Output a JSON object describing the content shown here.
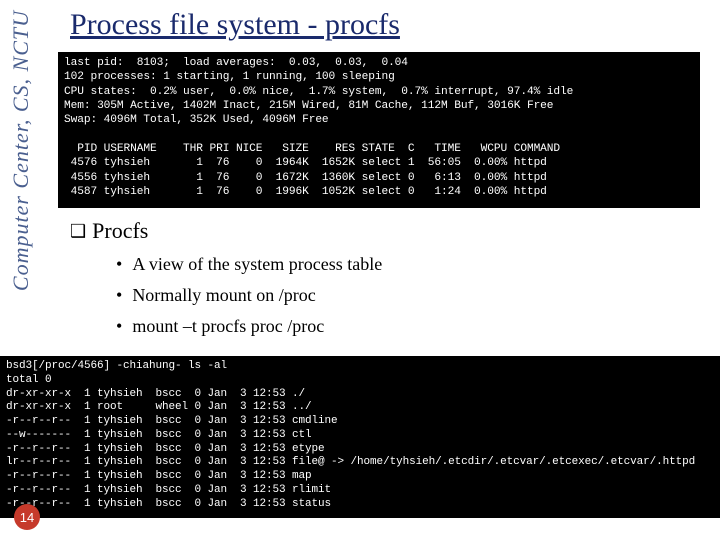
{
  "sidebar": {
    "org": "Computer Center, CS, NCTU"
  },
  "title": "Process file system - procfs",
  "terminal1": {
    "lines": [
      "last pid:  8103;  load averages:  0.03,  0.03,  0.04",
      "102 processes: 1 starting, 1 running, 100 sleeping",
      "CPU states:  0.2% user,  0.0% nice,  1.7% system,  0.7% interrupt, 97.4% idle",
      "Mem: 305M Active, 1402M Inact, 215M Wired, 81M Cache, 112M Buf, 3016K Free",
      "Swap: 4096M Total, 352K Used, 4096M Free",
      "",
      "  PID USERNAME    THR PRI NICE   SIZE    RES STATE  C   TIME   WCPU COMMAND",
      " 4576 tyhsieh       1  76    0  1964K  1652K select 1  56:05  0.00% httpd",
      " 4556 tyhsieh       1  76    0  1672K  1360K select 0   6:13  0.00% httpd",
      " 4587 tyhsieh       1  76    0  1996K  1052K select 0   1:24  0.00% httpd"
    ]
  },
  "section": {
    "heading": "Procfs",
    "bullets": [
      "A view of the system process table",
      "Normally mount on /proc",
      "mount –t procfs proc /proc"
    ]
  },
  "terminal2": {
    "lines": [
      "bsd3[/proc/4566] -chiahung- ls -al",
      "total 0",
      "dr-xr-xr-x  1 tyhsieh  bscc  0 Jan  3 12:53 ./",
      "dr-xr-xr-x  1 root     wheel 0 Jan  3 12:53 ../",
      "-r--r--r--  1 tyhsieh  bscc  0 Jan  3 12:53 cmdline",
      "--w-------  1 tyhsieh  bscc  0 Jan  3 12:53 ctl",
      "-r--r--r--  1 tyhsieh  bscc  0 Jan  3 12:53 etype",
      "lr--r--r--  1 tyhsieh  bscc  0 Jan  3 12:53 file@ -> /home/tyhsieh/.etcdir/.etcvar/.etcexec/.etcvar/.httpd",
      "-r--r--r--  1 tyhsieh  bscc  0 Jan  3 12:53 map",
      "-r--r--r--  1 tyhsieh  bscc  0 Jan  3 12:53 rlimit",
      "-r--r--r--  1 tyhsieh  bscc  0 Jan  3 12:53 status"
    ]
  },
  "page_number": "14"
}
